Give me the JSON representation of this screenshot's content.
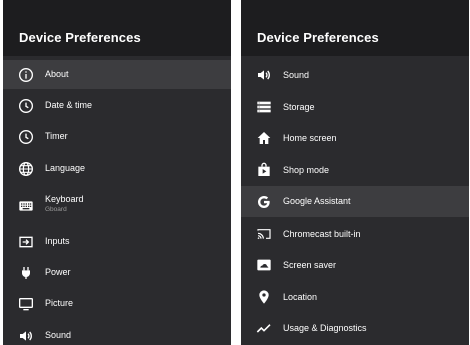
{
  "left_panel": {
    "title": "Device Preferences",
    "items": [
      {
        "label": "About",
        "icon": "info-icon",
        "selected": true
      },
      {
        "label": "Date & time",
        "icon": "clock-icon"
      },
      {
        "label": "Timer",
        "icon": "timer-icon"
      },
      {
        "label": "Language",
        "icon": "globe-icon"
      },
      {
        "label": "Keyboard",
        "sublabel": "Gboard",
        "icon": "keyboard-icon"
      },
      {
        "label": "Inputs",
        "icon": "input-icon"
      },
      {
        "label": "Power",
        "icon": "power-plug-icon"
      },
      {
        "label": "Picture",
        "icon": "monitor-icon"
      },
      {
        "label": "Sound",
        "icon": "speaker-icon"
      }
    ]
  },
  "right_panel": {
    "title": "Device Preferences",
    "items": [
      {
        "label": "Sound",
        "icon": "speaker-icon"
      },
      {
        "label": "Storage",
        "icon": "storage-icon"
      },
      {
        "label": "Home screen",
        "icon": "home-icon"
      },
      {
        "label": "Shop mode",
        "icon": "shop-bag-icon"
      },
      {
        "label": "Google Assistant",
        "icon": "google-g-icon",
        "selected": true
      },
      {
        "label": "Chromecast built-in",
        "icon": "cast-icon"
      },
      {
        "label": "Screen saver",
        "icon": "screen-saver-icon"
      },
      {
        "label": "Location",
        "icon": "location-pin-icon"
      },
      {
        "label": "Usage & Diagnostics",
        "icon": "trend-line-icon"
      }
    ]
  },
  "colors": {
    "panel_bg": "#2b2b2e",
    "header_bg": "#1d1d1f",
    "selected_bg": "#3d3d40",
    "text": "#ffffff",
    "subtext": "#9b9b9b"
  }
}
